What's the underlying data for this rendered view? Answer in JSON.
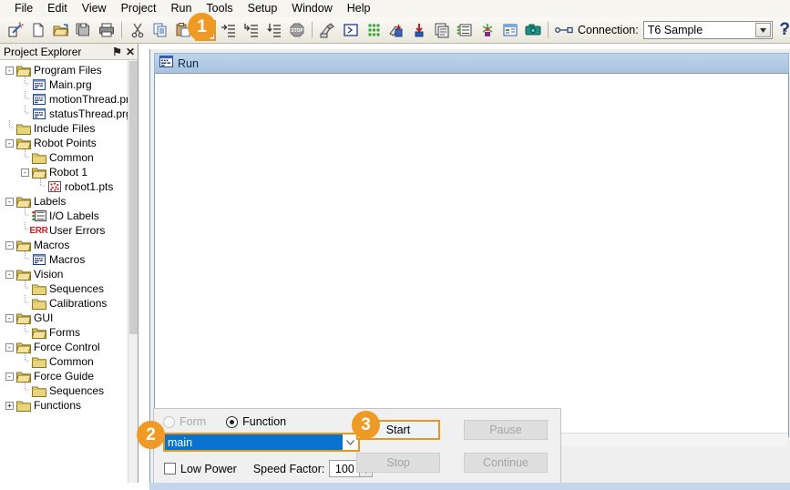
{
  "menubar": {
    "items": [
      {
        "label": "File"
      },
      {
        "label": "Edit"
      },
      {
        "label": "View"
      },
      {
        "label": "Project"
      },
      {
        "label": "Run"
      },
      {
        "label": "Tools"
      },
      {
        "label": "Setup"
      },
      {
        "label": "Window"
      },
      {
        "label": "Help"
      }
    ]
  },
  "toolbar": {
    "connection_label": "Connection:",
    "connection_value": "T6 Sample",
    "help_label": "?",
    "overflow_label": "≡",
    "buttons": [
      {
        "name": "new-project-icon",
        "title": "New Project"
      },
      {
        "name": "new-file-icon",
        "title": "New File"
      },
      {
        "name": "open-file-icon",
        "title": "Open File"
      },
      {
        "name": "save-all-icon",
        "title": "Save All"
      },
      {
        "name": "print-icon",
        "title": "Print"
      },
      {
        "name": "cut-icon",
        "title": "Cut"
      },
      {
        "name": "copy-icon",
        "title": "Copy"
      },
      {
        "name": "paste-icon",
        "title": "Paste"
      },
      {
        "name": "run-window-icon",
        "title": "Run Window"
      },
      {
        "name": "step-into-icon",
        "title": "Step Into"
      },
      {
        "name": "step-over-icon",
        "title": "Step Over"
      },
      {
        "name": "step-out-icon",
        "title": "Step Out"
      },
      {
        "name": "stop-icon",
        "title": "Stop"
      },
      {
        "name": "robot-manager-icon",
        "title": "Robot Manager"
      },
      {
        "name": "command-window-icon",
        "title": "Command Window"
      },
      {
        "name": "io-monitor-icon",
        "title": "I/O Monitor"
      },
      {
        "name": "task-manager-icon",
        "title": "Task Manager"
      },
      {
        "name": "force-monitor-icon",
        "title": "Force Monitor"
      },
      {
        "name": "simulator-icon",
        "title": "Simulator"
      },
      {
        "name": "io-labels-icon",
        "title": "I/O Labels"
      },
      {
        "name": "vision-icon",
        "title": "Vision Guide"
      },
      {
        "name": "gui-builder-icon",
        "title": "GUI Builder"
      },
      {
        "name": "camera-icon",
        "title": "Camera"
      }
    ]
  },
  "explorer": {
    "title": "Project Explorer",
    "pin_icon": "⚑",
    "close_icon": "✕",
    "tree": [
      {
        "label": "Program Files",
        "indent": 0,
        "expander": "-",
        "icon": "folder-open"
      },
      {
        "label": "Main.prg",
        "indent": 1,
        "expander": "",
        "icon": "prg"
      },
      {
        "label": "motionThread.prg",
        "indent": 1,
        "expander": "",
        "icon": "prg"
      },
      {
        "label": "statusThread.prg",
        "indent": 1,
        "expander": "",
        "icon": "prg"
      },
      {
        "label": "Include Files",
        "indent": 0,
        "expander": "",
        "icon": "folder"
      },
      {
        "label": "Robot Points",
        "indent": 0,
        "expander": "-",
        "icon": "folder-open"
      },
      {
        "label": "Common",
        "indent": 1,
        "expander": "",
        "icon": "folder"
      },
      {
        "label": "Robot 1",
        "indent": 1,
        "expander": "-",
        "icon": "folder-open"
      },
      {
        "label": "robot1.pts",
        "indent": 2,
        "expander": "",
        "icon": "pts"
      },
      {
        "label": "Labels",
        "indent": 0,
        "expander": "-",
        "icon": "folder-open"
      },
      {
        "label": "I/O Labels",
        "indent": 1,
        "expander": "",
        "icon": "iolabels"
      },
      {
        "label": "User Errors",
        "indent": 1,
        "expander": "",
        "icon": "err"
      },
      {
        "label": "Macros",
        "indent": 0,
        "expander": "-",
        "icon": "folder-open"
      },
      {
        "label": "Macros",
        "indent": 1,
        "expander": "",
        "icon": "prg"
      },
      {
        "label": "Vision",
        "indent": 0,
        "expander": "-",
        "icon": "folder-open"
      },
      {
        "label": "Sequences",
        "indent": 1,
        "expander": "",
        "icon": "folder"
      },
      {
        "label": "Calibrations",
        "indent": 1,
        "expander": "",
        "icon": "folder"
      },
      {
        "label": "GUI",
        "indent": 0,
        "expander": "-",
        "icon": "folder-open"
      },
      {
        "label": "Forms",
        "indent": 1,
        "expander": "",
        "icon": "folder-open"
      },
      {
        "label": "Force Control",
        "indent": 0,
        "expander": "-",
        "icon": "folder-open"
      },
      {
        "label": "Common",
        "indent": 1,
        "expander": "",
        "icon": "folder"
      },
      {
        "label": "Force Guide",
        "indent": 0,
        "expander": "-",
        "icon": "folder-open"
      },
      {
        "label": "Sequences",
        "indent": 1,
        "expander": "",
        "icon": "folder"
      },
      {
        "label": "Functions",
        "indent": 0,
        "expander": "+",
        "icon": "folder"
      }
    ]
  },
  "run_window": {
    "title": "Run",
    "scroll_left_icon": "‹"
  },
  "control_panel": {
    "form_label": "Form",
    "function_label": "Function",
    "selected_mode": "Function",
    "function_value": "main",
    "combo_arrow_icon": "⌄",
    "low_power_label": "Low Power",
    "low_power_checked": false,
    "speed_factor_label": "Speed Factor:",
    "speed_factor_value": "100",
    "percent_label": "%",
    "spin_up_icon": "▲",
    "spin_down_icon": "▼",
    "start_label": "Start",
    "pause_label": "Pause",
    "stop_label": "Stop",
    "continue_label": "Continue"
  },
  "annotations": {
    "badges": [
      {
        "label": "1"
      },
      {
        "label": "2"
      },
      {
        "label": "3"
      }
    ],
    "accent_color": "#EF9A24",
    "highlight_border_color": "#E8971C"
  }
}
